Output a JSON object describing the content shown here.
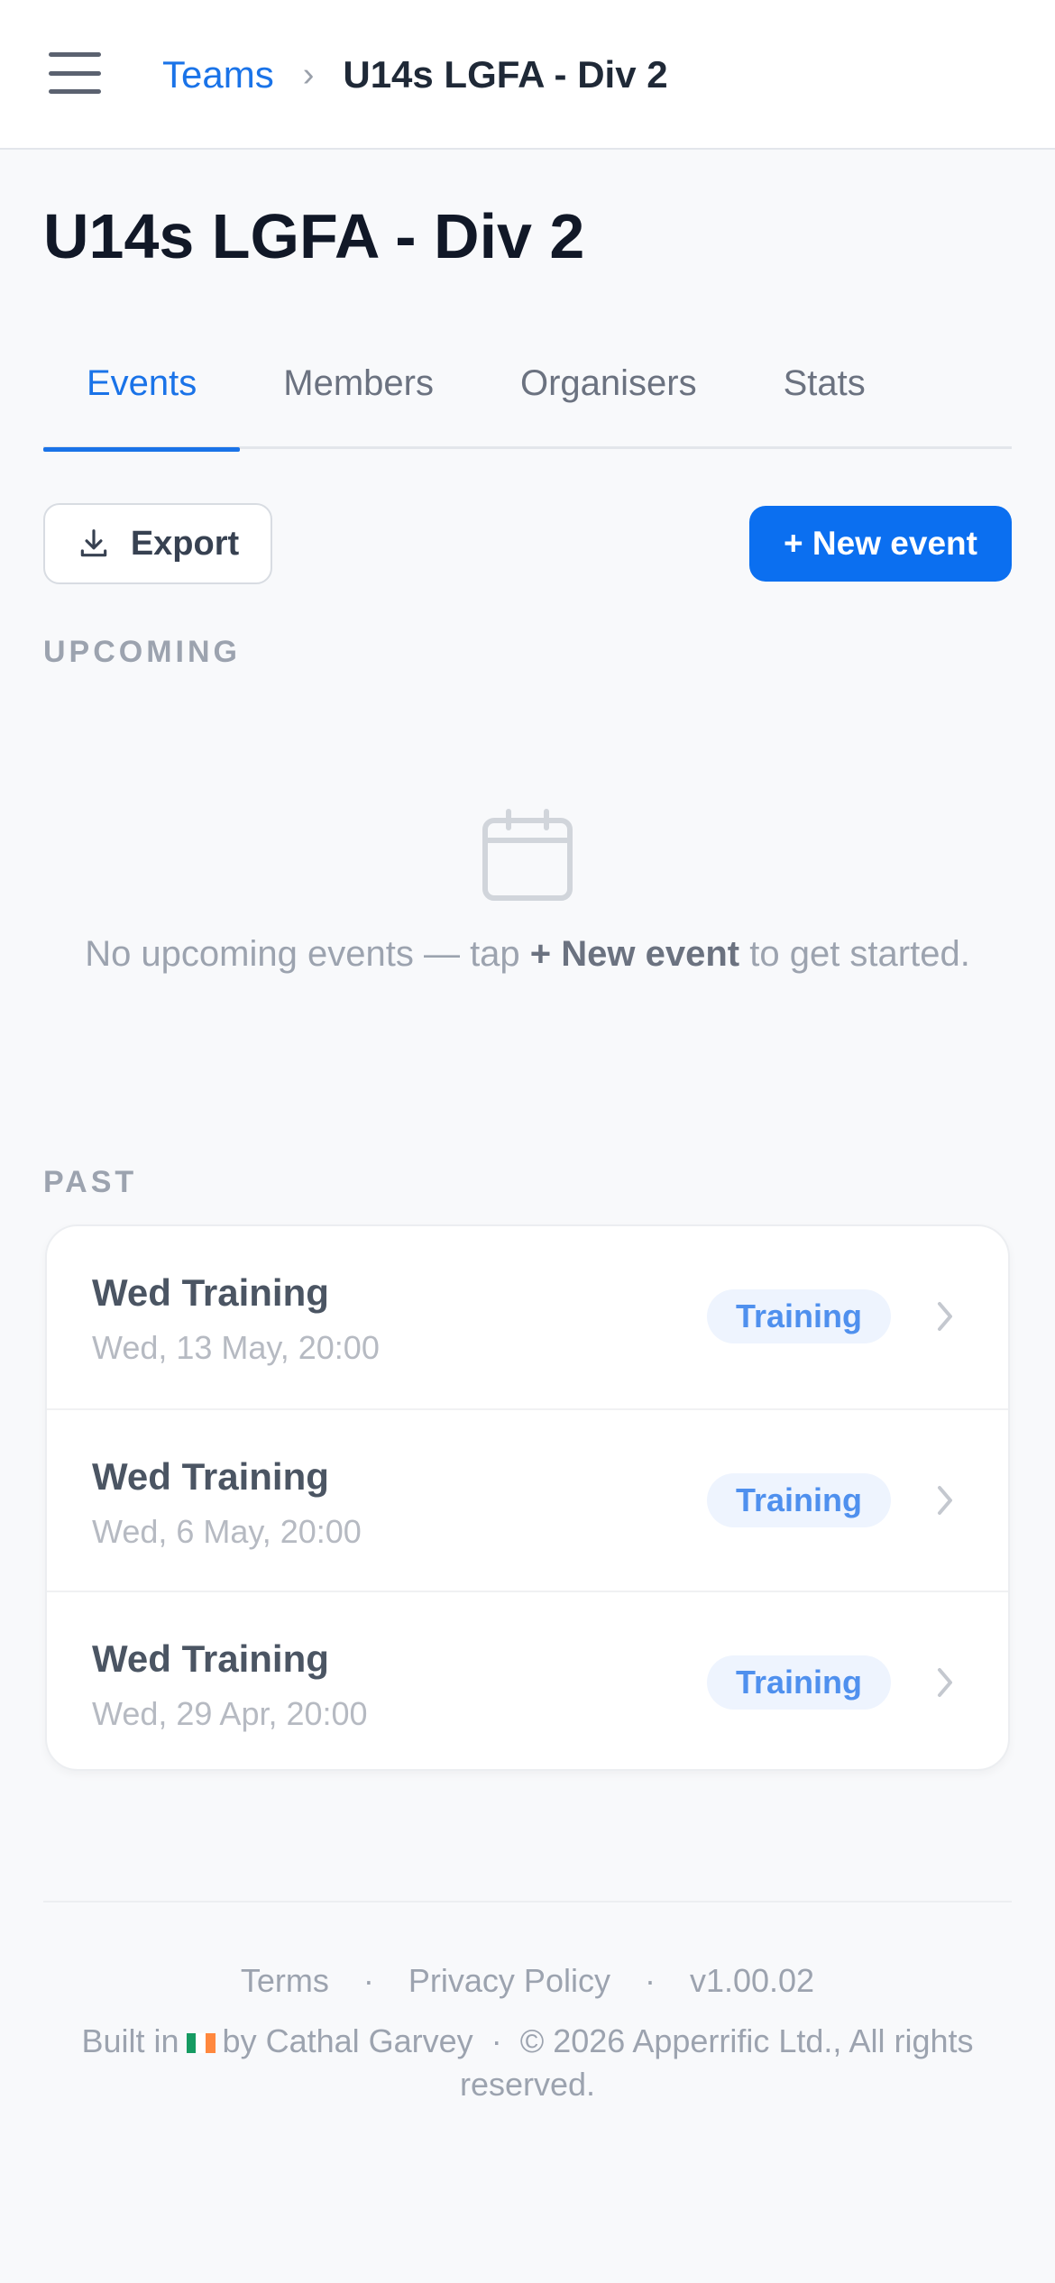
{
  "header": {
    "breadcrumb_parent": "Teams",
    "breadcrumb_separator": "›",
    "breadcrumb_current": "U14s LGFA - Div 2"
  },
  "page": {
    "title": "U14s LGFA - Div 2"
  },
  "tabs": [
    {
      "label": "Events",
      "active": true
    },
    {
      "label": "Members",
      "active": false
    },
    {
      "label": "Organisers",
      "active": false
    },
    {
      "label": "Stats",
      "active": false
    }
  ],
  "toolbar": {
    "export_label": "Export",
    "new_event_label": "+ New event"
  },
  "upcoming": {
    "section_label": "UPCOMING",
    "empty_prefix": "No upcoming events — tap ",
    "empty_bold": "+ New event",
    "empty_suffix": " to get started."
  },
  "past": {
    "section_label": "PAST",
    "events": [
      {
        "title": "Wed Training",
        "datetime": "Wed, 13 May, 20:00",
        "badge": "Training"
      },
      {
        "title": "Wed Training",
        "datetime": "Wed, 6 May, 20:00",
        "badge": "Training"
      },
      {
        "title": "Wed Training",
        "datetime": "Wed, 29 Apr, 20:00",
        "badge": "Training"
      }
    ]
  },
  "footer": {
    "terms": "Terms",
    "privacy": "Privacy Policy",
    "version": "v1.00.02",
    "separator": "·",
    "built_prefix": "Built in",
    "built_suffix": "by Cathal Garvey",
    "copyright": "© 2026 Apperrific Ltd., All rights reserved."
  },
  "colors": {
    "accent": "#1a73e8",
    "primary_button": "#0b6ff0",
    "badge_bg": "#eef4fe",
    "badge_text": "#4f90ee"
  },
  "icons": [
    "menu-icon",
    "download-icon",
    "calendar-icon",
    "chevron-right-icon",
    "ireland-flag-icon"
  ]
}
